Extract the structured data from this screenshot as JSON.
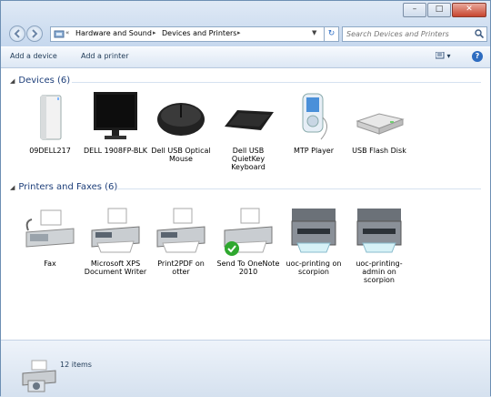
{
  "window": {
    "caption_buttons": [
      "minimize-icon",
      "maximize-icon",
      "close-icon"
    ]
  },
  "address": {
    "overflow": "«",
    "crumbs": [
      "Hardware and Sound",
      "Devices and Printers"
    ],
    "separator": "▸"
  },
  "search": {
    "placeholder": "Search Devices and Printers"
  },
  "toolbar": {
    "add_device": "Add a device",
    "add_printer": "Add a printer",
    "view": "▾"
  },
  "groups": {
    "devices": {
      "title": "Devices (6)"
    },
    "printers": {
      "title": "Printers and Faxes (6)"
    }
  },
  "devices": [
    {
      "label": "09DELL217",
      "icon": "computer-tower-icon"
    },
    {
      "label": "DELL 1908FP-BLK",
      "icon": "monitor-icon"
    },
    {
      "label": "Dell USB Optical Mouse",
      "icon": "mouse-icon"
    },
    {
      "label": "Dell USB QuietKey Keyboard",
      "icon": "keyboard-icon"
    },
    {
      "label": "MTP Player",
      "icon": "media-player-icon"
    },
    {
      "label": "USB Flash Disk",
      "icon": "flash-disk-icon"
    }
  ],
  "printers": [
    {
      "label": "Fax",
      "icon": "fax-icon"
    },
    {
      "label": "Microsoft XPS Document Writer",
      "icon": "printer-icon"
    },
    {
      "label": "Print2PDF on otter",
      "icon": "printer-icon"
    },
    {
      "label": "Send To OneNote 2010",
      "icon": "default-printer-icon"
    },
    {
      "label": "uoc-printing on scorpion",
      "icon": "network-printer-icon"
    },
    {
      "label": "uoc-printing-admin on scorpion",
      "icon": "network-printer-icon"
    }
  ],
  "status": {
    "count": "12 items"
  },
  "colors": {
    "titlebar": "#c6d8ee",
    "accent": "#1e3f7a",
    "default_badge": "#2fa82f"
  }
}
